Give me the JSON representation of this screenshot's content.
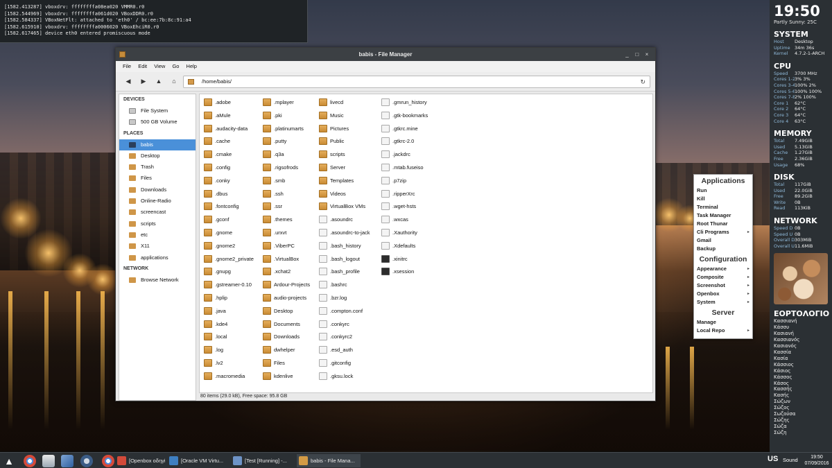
{
  "dmesg": {
    "lines": [
      "[1582.413287] vboxdrv: ffffffffa08ea020 VMMR0.r0",
      "[1582.544969] vboxdrv: ffffffffa061d020 VBoxDDR0.r0",
      "[1582.584337] VBoxNetFlt: attached to 'eth0' / bc:ee:7b:8c:91:a4",
      "[1582.615910] vboxdrv: ffffffffa0006020 VBoxEhciR0.r0",
      "[1582.617465] device eth0 entered promiscuous mode"
    ]
  },
  "conky": {
    "clock": "19:50",
    "weather": "Partly Sunny: 25C",
    "system_title": "SYSTEM",
    "system": [
      {
        "k": "Host",
        "v": "Desktop"
      },
      {
        "k": "Uptime",
        "v": "34m 36s"
      },
      {
        "k": "Kernel",
        "v": "4.7.2-1-ARCH"
      }
    ],
    "cpu_title": "CPU",
    "cpu": [
      {
        "k": "Speed",
        "v": "3700 MHz"
      },
      {
        "k": "Cores 1-2",
        "v": "3% 3%"
      },
      {
        "k": "Cores 3-4",
        "v": "100% 2%"
      },
      {
        "k": "Cores 5-6",
        "v": "100% 100%"
      },
      {
        "k": "Cores 7-8",
        "v": "2% 100%"
      },
      {
        "k": "Core 1",
        "v": "62°C"
      },
      {
        "k": "Core 2",
        "v": "64°C"
      },
      {
        "k": "Core 3",
        "v": "64°C"
      },
      {
        "k": "Core 4",
        "v": "63°C"
      }
    ],
    "memory_title": "MEMORY",
    "memory": [
      {
        "k": "Total",
        "v": "7.49GiB"
      },
      {
        "k": "Used",
        "v": "5.13GiB"
      },
      {
        "k": "Cache",
        "v": "1.27GiB"
      },
      {
        "k": "Free",
        "v": "2.36GiB"
      },
      {
        "k": "Usage",
        "v": "68%"
      }
    ],
    "disk_title": "DISK",
    "disk": [
      {
        "k": "Total",
        "v": "117GiB"
      },
      {
        "k": "Used",
        "v": "22.0GiB"
      },
      {
        "k": "Free",
        "v": "89.2GiB"
      },
      {
        "k": "Write",
        "v": "0B"
      },
      {
        "k": "Read",
        "v": "113KiB"
      }
    ],
    "network_title": "NETWORK",
    "network": [
      {
        "k": "Speed D",
        "v": "0B"
      },
      {
        "k": "Speed U",
        "v": "0B"
      },
      {
        "k": "Overall D",
        "v": "303MiB"
      },
      {
        "k": "Overall U",
        "v": "11.6MiB"
      }
    ],
    "namedays_title": "ΕΟΡΤΟΛΟΓΙΟ",
    "namedays": [
      "Κασσιανή",
      "Κάσσυ",
      "Κασιανή",
      "Κασσιανός",
      "Κασιανός",
      "Κασσία",
      "Κασία",
      "Κάσσιος",
      "Κάσιος",
      "Κάσσος",
      "Κάσος",
      "Κασσής",
      "Κασής",
      "Σώζων",
      "Σώζος",
      "Σωζούσα",
      "Σώζης",
      "Σώζα",
      "Σώζη"
    ]
  },
  "obmenu": {
    "applications_title": "Applications",
    "applications": [
      {
        "label": "Run",
        "sub": false
      },
      {
        "label": "Kill",
        "sub": false
      },
      {
        "label": "Terminal",
        "sub": false
      },
      {
        "label": "Task Manager",
        "sub": false
      },
      {
        "label": "Root Thunar",
        "sub": false
      },
      {
        "label": "Cli Programs",
        "sub": true
      },
      {
        "label": "Gmail",
        "sub": false
      },
      {
        "label": "Backup",
        "sub": false
      }
    ],
    "configuration_title": "Configuration",
    "configuration": [
      {
        "label": "Appearance",
        "sub": true
      },
      {
        "label": "Composite",
        "sub": true
      },
      {
        "label": "Screenshot",
        "sub": true
      },
      {
        "label": "Openbox",
        "sub": true
      },
      {
        "label": "System",
        "sub": true
      }
    ],
    "server_title": "Server",
    "server": [
      {
        "label": "Manage",
        "sub": false
      },
      {
        "label": "Local Repo",
        "sub": true
      }
    ],
    "submenu_arrow": "▸"
  },
  "fm": {
    "title": "babis - File Manager",
    "controls": {
      "minimize": "_",
      "maximize": "□",
      "close": "×"
    },
    "menu": [
      "File",
      "Edit",
      "View",
      "Go",
      "Help"
    ],
    "toolbar": {
      "back": "◀",
      "forward": "▶",
      "up": "▲",
      "home": "⌂",
      "reload": "↻"
    },
    "path": "/home/babis/",
    "side": {
      "devices_title": "DEVICES",
      "devices": [
        "File System",
        "500 GB Volume"
      ],
      "places_title": "PLACES",
      "places": [
        "babis",
        "Desktop",
        "Trash",
        "Files",
        "Downloads",
        "Online-Radio",
        "screencast",
        "scripts",
        "etc",
        "X11",
        "applications"
      ],
      "selected_place": "babis",
      "network_title": "NETWORK",
      "network": [
        "Browse Network"
      ]
    },
    "columns": [
      [
        {
          "name": ".adobe",
          "type": "folder"
        },
        {
          "name": ".aMule",
          "type": "folder"
        },
        {
          "name": ".audacity-data",
          "type": "folder"
        },
        {
          "name": ".cache",
          "type": "folder"
        },
        {
          "name": ".cmake",
          "type": "folder"
        },
        {
          "name": ".config",
          "type": "folder"
        },
        {
          "name": ".conky",
          "type": "folder"
        },
        {
          "name": ".dbus",
          "type": "folder"
        },
        {
          "name": ".fontconfig",
          "type": "folder"
        },
        {
          "name": ".gconf",
          "type": "folder"
        },
        {
          "name": ".gnome",
          "type": "folder"
        },
        {
          "name": ".gnome2",
          "type": "folder"
        },
        {
          "name": ".gnome2_private",
          "type": "folder"
        },
        {
          "name": ".gnupg",
          "type": "folder"
        },
        {
          "name": ".gstreamer-0.10",
          "type": "folder"
        },
        {
          "name": ".hplip",
          "type": "folder"
        },
        {
          "name": ".java",
          "type": "folder"
        },
        {
          "name": ".kde4",
          "type": "folder"
        },
        {
          "name": ".local",
          "type": "folder"
        },
        {
          "name": ".log",
          "type": "folder"
        },
        {
          "name": ".lv2",
          "type": "folder"
        },
        {
          "name": ".macromedia",
          "type": "folder"
        }
      ],
      [
        {
          "name": ".mplayer",
          "type": "folder"
        },
        {
          "name": ".pki",
          "type": "folder"
        },
        {
          "name": ".platinumarts",
          "type": "folder"
        },
        {
          "name": ".putty",
          "type": "folder"
        },
        {
          "name": ".q3a",
          "type": "folder"
        },
        {
          "name": ".rigsofrods",
          "type": "folder"
        },
        {
          "name": ".smb",
          "type": "folder"
        },
        {
          "name": ".ssh",
          "type": "folder"
        },
        {
          "name": ".ssr",
          "type": "folder"
        },
        {
          "name": ".themes",
          "type": "folder"
        },
        {
          "name": ".urxvt",
          "type": "folder"
        },
        {
          "name": ".ViberPC",
          "type": "folder"
        },
        {
          "name": ".VirtualBox",
          "type": "folder"
        },
        {
          "name": ".xchat2",
          "type": "folder"
        },
        {
          "name": "Ardour-Projects",
          "type": "folder"
        },
        {
          "name": "audio-projects",
          "type": "folder"
        },
        {
          "name": "Desktop",
          "type": "folder"
        },
        {
          "name": "Documents",
          "type": "folder"
        },
        {
          "name": "Downloads",
          "type": "folder"
        },
        {
          "name": "dwhelper",
          "type": "folder"
        },
        {
          "name": "Files",
          "type": "folder"
        },
        {
          "name": "kdenlive",
          "type": "folder"
        }
      ],
      [
        {
          "name": "livecd",
          "type": "folder"
        },
        {
          "name": "Music",
          "type": "folder"
        },
        {
          "name": "Pictures",
          "type": "folder"
        },
        {
          "name": "Public",
          "type": "folder"
        },
        {
          "name": "scripts",
          "type": "folder"
        },
        {
          "name": "Server",
          "type": "folder"
        },
        {
          "name": "Templates",
          "type": "folder"
        },
        {
          "name": "Videos",
          "type": "folder"
        },
        {
          "name": "VirtualBox VMs",
          "type": "folder"
        },
        {
          "name": ".asoundrc",
          "type": "doc"
        },
        {
          "name": ".asoundrc-to-jack",
          "type": "doc"
        },
        {
          "name": ".bash_history",
          "type": "doc"
        },
        {
          "name": ".bash_logout",
          "type": "doc"
        },
        {
          "name": ".bash_profile",
          "type": "doc"
        },
        {
          "name": ".bashrc",
          "type": "doc"
        },
        {
          "name": ".bzr.log",
          "type": "doc"
        },
        {
          "name": ".compton.conf",
          "type": "doc"
        },
        {
          "name": ".conkyrc",
          "type": "doc"
        },
        {
          "name": ".conkyrc2",
          "type": "doc"
        },
        {
          "name": ".esd_auth",
          "type": "doc"
        },
        {
          "name": ".gitconfig",
          "type": "doc"
        },
        {
          "name": ".gksu.lock",
          "type": "doc"
        }
      ],
      [
        {
          "name": ".gmrun_history",
          "type": "doc"
        },
        {
          "name": ".gtk-bookmarks",
          "type": "doc"
        },
        {
          "name": ".gtkrc.mine",
          "type": "doc"
        },
        {
          "name": ".gtkrc-2.0",
          "type": "doc"
        },
        {
          "name": ".jackdrc",
          "type": "doc"
        },
        {
          "name": ".mtab.fuseiso",
          "type": "doc"
        },
        {
          "name": ".p7zip",
          "type": "doc"
        },
        {
          "name": ".ripperXrc",
          "type": "doc"
        },
        {
          "name": ".wget-hsts",
          "type": "doc"
        },
        {
          "name": ".wxcas",
          "type": "doc"
        },
        {
          "name": ".Xauthority",
          "type": "doc"
        },
        {
          "name": ".Xdefaults",
          "type": "doc"
        },
        {
          "name": ".xinitrc",
          "type": "term"
        },
        {
          "name": ".xsession",
          "type": "term"
        }
      ]
    ],
    "status": "80 items (29.0 kB), Free space: 95.8 GB"
  },
  "taskbar": {
    "tasks": [
      {
        "label": "[Openbox οδηγίε...",
        "icon": "chrome-icon",
        "color": "#d24a3a"
      },
      {
        "label": "[Oracle VM Virtu...",
        "icon": "monitor-icon",
        "color": "#3e7fc1"
      },
      {
        "label": "[Test [Running] -...",
        "icon": "virtualbox-icon",
        "color": "#6e93c6"
      },
      {
        "label": "babis - File Mana...",
        "icon": "folder-icon",
        "color": "#d29a45"
      }
    ],
    "lang": "US",
    "sound": "Sound",
    "time": "19:50",
    "date": "07/09/2016"
  }
}
